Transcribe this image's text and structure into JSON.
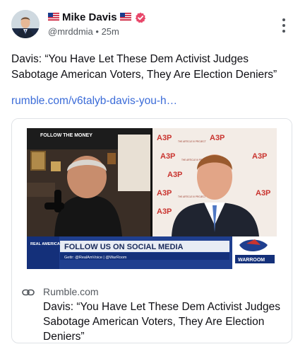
{
  "post": {
    "author": {
      "name": "Mike Davis",
      "handle": "@mrddmia",
      "time": "25m"
    },
    "text": "Davis: “You Have Let These Dem Activist Judges Sabotage American Voters, They Are Election Deniers”",
    "link_text": "rumble.com/v6talyb-davis-you-h…"
  },
  "card": {
    "domain": "Rumble.com",
    "title": "Davis: “You Have Let These Dem Activist Judges Sabotage American Voters, They Are Election Deniers”"
  },
  "video": {
    "banner_main": "FOLLOW US ON SOCIAL MEDIA",
    "banner_sub": "Gettr: @RealAmVoice | @WarRoom",
    "network_logo": "REAL AMERICA'S VOICE",
    "show_logo": "WARROOM",
    "backdrop_text": "A3P",
    "backdrop_caption": "THE ARTICLE III PROJECT",
    "sign_text": "FOLLOW THE MONEY"
  },
  "colors": {
    "link": "#3a6bd8",
    "verified": "#e8476a",
    "banner_blue": "#1f3f8f"
  },
  "icons": {
    "verified": "verified-badge-icon",
    "more": "kebab-menu-icon",
    "link": "link-icon"
  }
}
